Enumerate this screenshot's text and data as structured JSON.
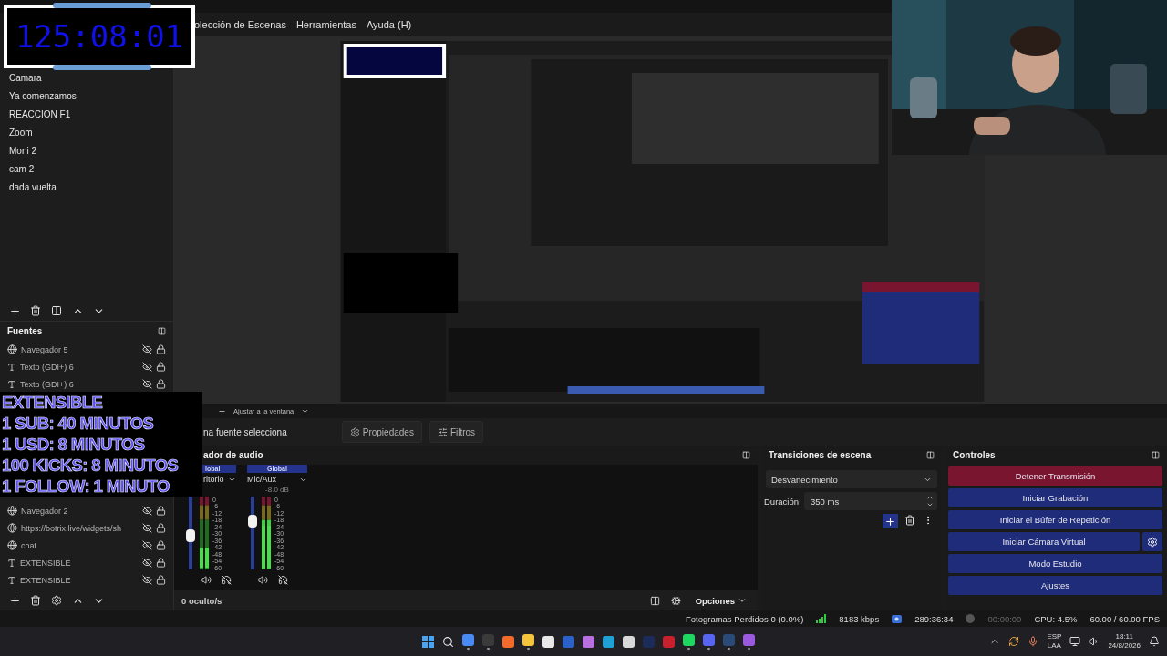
{
  "menu": [
    "olección de Escenas",
    "Herramientas",
    "Ayuda (H)"
  ],
  "timer_overlay": {
    "text": "125:08:01"
  },
  "goal_overlay": {
    "lines": [
      "EXTENSIBLE",
      "1 SUB: 40 MINUTOS",
      "1 USD: 8 MINUTOS",
      "100 KICKS: 8 MINUTOS",
      "1 FOLLOW: 1 MINUTO"
    ]
  },
  "scenes": [
    "Camara",
    "Ya comenzamos",
    "REACCION F1",
    "Zoom",
    "Moni 2",
    "cam 2",
    "dada vuelta"
  ],
  "sources": {
    "title": "Fuentes",
    "items": [
      {
        "kind": "browser",
        "label": "Navegador 5"
      },
      {
        "kind": "text",
        "label": "Texto (GDI+) 6"
      },
      {
        "kind": "text",
        "label": "Texto (GDI+) 6"
      },
      {
        "kind": "browser",
        "label": "Navegador 2"
      },
      {
        "kind": "browser",
        "label": "https://botrix.live/widgets/sh"
      },
      {
        "kind": "browser",
        "label": "chat"
      },
      {
        "kind": "text",
        "label": "EXTENSIBLE"
      },
      {
        "kind": "text",
        "label": "EXTENSIBLE"
      }
    ]
  },
  "preview_toolbar": {
    "zoom": "Ajustar a la ventana"
  },
  "properties_bar": {
    "text": "na fuente selecciona",
    "buttons": [
      {
        "kind": "properties",
        "label": "Propiedades"
      },
      {
        "kind": "filters",
        "label": "Filtros"
      }
    ]
  },
  "audio_mixer": {
    "title": "ador de audio",
    "channels": [
      {
        "scope": "lobal",
        "name": "ritorio",
        "level": 0.45,
        "meter_scale": [
          "0",
          "-6",
          "-12",
          "-18",
          "-24",
          "-30",
          "-36",
          "-42",
          "-48",
          "-54",
          "-60"
        ]
      },
      {
        "scope": "Global",
        "name": "Mic/Aux",
        "db": "-8.0 dB",
        "level": 0.7,
        "meter_scale": [
          "0",
          "-6",
          "-12",
          "-18",
          "-24",
          "-30",
          "-36",
          "-42",
          "-48",
          "-54",
          "-60"
        ]
      }
    ],
    "hidden_count": "0 oculto/s",
    "options": "Opciones"
  },
  "transitions": {
    "title": "Transiciones de escena",
    "type": "Desvanecimiento",
    "duration_label": "Duración",
    "duration": "350 ms"
  },
  "controls": {
    "title": "Controles",
    "buttons": [
      {
        "kind": "stop",
        "label": "Detener Transmisión"
      },
      {
        "kind": "start",
        "label": "Iniciar Grabación"
      },
      {
        "kind": "start",
        "label": "Iniciar el Búfer de Repetición"
      },
      {
        "kind": "virtualcam",
        "label": "Iniciar Cámara Virtual"
      },
      {
        "kind": "start",
        "label": "Modo Estudio"
      },
      {
        "kind": "start",
        "label": "Ajustes"
      }
    ]
  },
  "status_bar": {
    "dropped": "Fotogramas Perdidos 0 (0.0%)",
    "bitrate": "8183 kbps",
    "stream_time": "289:36:34",
    "record_time": "00:00:00",
    "cpu": "CPU: 4.5%",
    "fps": "60.00 / 60.00 FPS"
  },
  "taskbar": {
    "apps": [
      {
        "color": "#4a8af4",
        "running": true
      },
      {
        "color": "#3a3a3a",
        "running": true
      },
      {
        "color": "#f26b2a",
        "running": false
      },
      {
        "color": "#f3c43c",
        "running": true
      },
      {
        "color": "#e8e8e8",
        "running": false
      },
      {
        "color": "#2b62c9",
        "running": false
      },
      {
        "color": "#b86fe0",
        "running": false
      },
      {
        "color": "#1fa1d6",
        "running": false
      },
      {
        "color": "#d9d9d9",
        "running": false
      },
      {
        "color": "#1b2b5a",
        "running": false
      },
      {
        "color": "#c8202d",
        "running": false
      },
      {
        "color": "#1ed760",
        "running": true
      },
      {
        "color": "#5865f2",
        "running": true
      },
      {
        "color": "#2a4a78",
        "running": true
      },
      {
        "color": "#9b59e0",
        "running": true
      }
    ],
    "lang": "ESP",
    "layout": "LAA",
    "time": "18:11",
    "date": "24/8/2026"
  }
}
